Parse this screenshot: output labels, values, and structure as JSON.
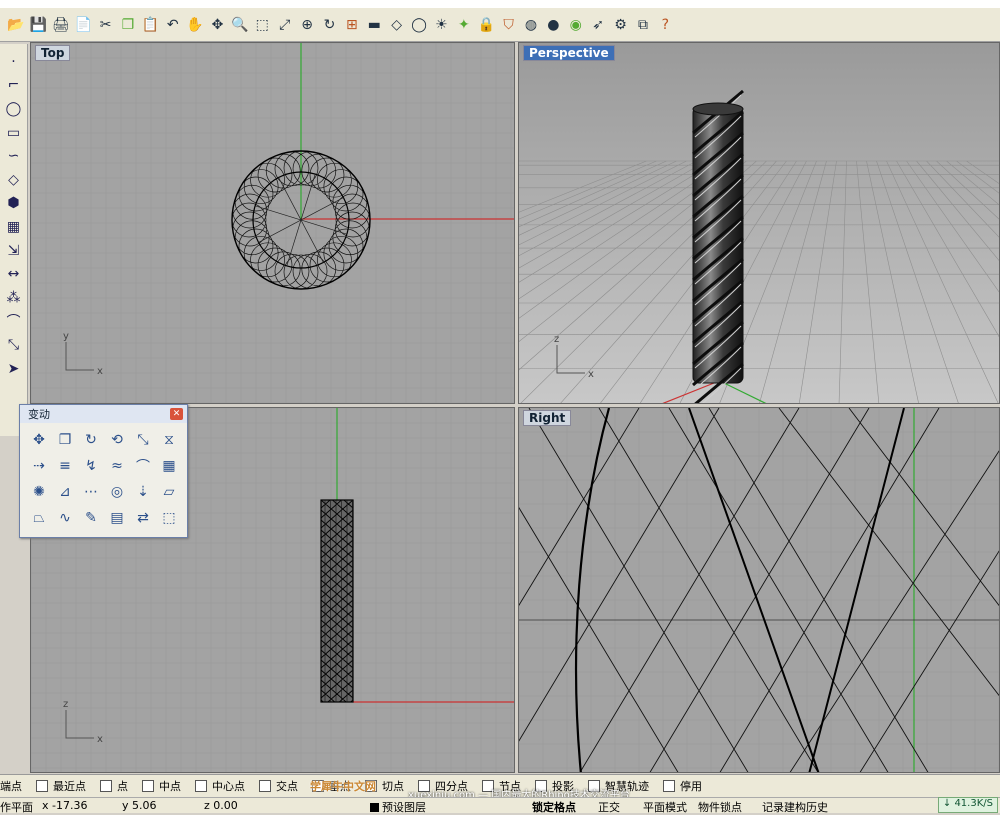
{
  "toolbar_icons": [
    "folder-open-icon",
    "save-icon",
    "print-icon",
    "document-icon",
    "cut-icon",
    "copy-icon",
    "paste-icon",
    "undo-icon",
    "pan-hand-icon",
    "rotate-view-icon",
    "zoom-icon",
    "zoom-window-icon",
    "zoom-extents-icon",
    "zoom-selected-icon",
    "rotate-icon",
    "four-viewports-icon",
    "car-icon",
    "surface-icon",
    "circle-icon",
    "lightbulb-icon",
    "light-icon",
    "lock-icon",
    "shield-icon",
    "color-wheel-icon",
    "sphere-icon",
    "sphere-render-icon",
    "arrow-flag-icon",
    "gear-icon",
    "arrange-icon",
    "help-icon"
  ],
  "left_toolbar_icons": [
    "point-icon",
    "polyline-icon",
    "circle-icon",
    "rectangle-icon",
    "curve-icon",
    "surface-icon",
    "solid-icon",
    "mesh-icon",
    "transform-icon",
    "dimension-icon",
    "group-icon",
    "curve-tools-icon",
    "scale-icon",
    "arrow-icon"
  ],
  "viewports": {
    "top": {
      "label": "Top"
    },
    "perspective": {
      "label": "Perspective"
    },
    "front": {
      "label": ""
    },
    "right": {
      "label": "Right"
    }
  },
  "axis_labels": {
    "x": "x",
    "y": "y",
    "z": "z"
  },
  "transform_panel": {
    "title": "变动",
    "icons": [
      "move-icon",
      "copy-icon",
      "rotate-icon",
      "rotate-3d-icon",
      "scale-icon",
      "mirror-icon",
      "orient-icon",
      "align-icon",
      "twist-icon",
      "flow-icon",
      "bend-icon",
      "array-icon",
      "polar-array-icon",
      "taper-icon",
      "array-curve-icon",
      "pipe-icon",
      "project-icon",
      "shear-icon",
      "taper-alt-icon",
      "flow-alt-icon",
      "splop-icon",
      "smash-icon",
      "unroll-icon",
      "box-edit-icon"
    ]
  },
  "osnap": {
    "items": [
      {
        "label": "端点",
        "checked": false
      },
      {
        "label": "最近点",
        "checked": false
      },
      {
        "label": "点",
        "checked": false
      },
      {
        "label": "中点",
        "checked": false
      },
      {
        "label": "中心点",
        "checked": false
      },
      {
        "label": "交点",
        "checked": false
      },
      {
        "label": "垂点",
        "checked": false
      },
      {
        "label": "切点",
        "checked": false
      },
      {
        "label": "四分点",
        "checked": false
      },
      {
        "label": "节点",
        "checked": false
      },
      {
        "label": "投影",
        "checked": false
      },
      {
        "label": "智慧轨迹",
        "checked": false
      },
      {
        "label": "停用",
        "checked": false
      }
    ]
  },
  "status": {
    "plane": "作平面",
    "x": "x -17.36",
    "y": "y 5.06",
    "z": "z 0.00",
    "layer": "预设图层",
    "grid_snap": "锁定格点",
    "ortho": "正交",
    "planar": "平面模式",
    "object_snap": "物件锁点",
    "history": "记录建构历史"
  },
  "network": "↓ 41.3K/S",
  "watermark": {
    "main": "学犀牛中文网",
    "sub": "xuexiniu.com — 国内最大的Rhino技术交流平台"
  },
  "colors": {
    "viewport_bg": "#a3a3a3",
    "grid": "#9a9a9a",
    "axis_x": "#c33",
    "axis_y": "#3a3",
    "active_label": "#3d6fb6"
  },
  "chart_data": {
    "type": "table",
    "title": "",
    "views": [
      "Top",
      "Perspective",
      "",
      "Right"
    ],
    "grid": true
  }
}
